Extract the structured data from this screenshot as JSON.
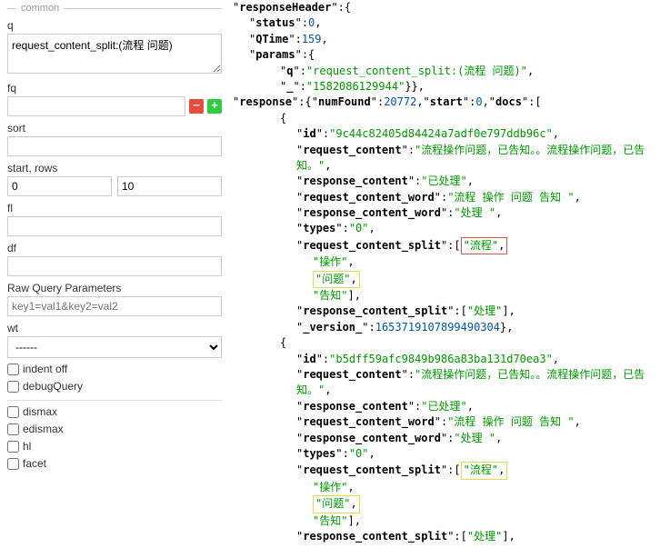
{
  "left": {
    "fieldset": "common",
    "q_label": "q",
    "q_value": "request_content_split:(流程 问题)",
    "fq_label": "fq",
    "fq_value": "",
    "sort_label": "sort",
    "sort_value": "",
    "startrows_label": "start, rows",
    "start_value": "0",
    "rows_value": "10",
    "fl_label": "fl",
    "fl_value": "",
    "df_label": "df",
    "df_value": "",
    "rawparams_label": "Raw Query Parameters",
    "rawparams_placeholder": "key1=val1&key2=val2",
    "rawparams_value": "",
    "wt_label": "wt",
    "wt_value": "------",
    "indent_label": "indent off",
    "debug_label": "debugQuery",
    "dismax_label": "dismax",
    "edismax_label": "edismax",
    "hl_label": "hl",
    "facet_label": "facet"
  },
  "json": {
    "responseHeader_key": "responseHeader",
    "status_key": "status",
    "status_val": "0",
    "qtime_key": "QTime",
    "qtime_val": "159",
    "params_key": "params",
    "q_key": "q",
    "q_val": "request_content_split:(流程 问题)",
    "underscore_key": "_",
    "underscore_val": "1582086129944",
    "response_key": "response",
    "numfound_key": "numFound",
    "numfound_val": "20772",
    "start_key": "start",
    "start_val": "0",
    "docs_key": "docs",
    "id_key": "id",
    "reqcontent_key": "request_content",
    "respcontent_key": "response_content",
    "reqword_key": "request_content_word",
    "respword_key": "response_content_word",
    "types_key": "types",
    "reqsplit_key": "request_content_split",
    "respsplit_key": "response_content_split",
    "version_key": "_version_",
    "doc1": {
      "id_val": "9c44c82405d84424a7adf0e797ddb96c",
      "reqcontent_val": "流程操作问题，已告知。。流程操作问题，已告知。",
      "respcontent_val": "已处理",
      "reqword_val": "流程 操作 问题 告知 ",
      "respword_val": "处理 ",
      "types_val": "0",
      "split1": "流程",
      "split2": "操作",
      "split3": "问题",
      "split4": "告知",
      "respsplit1": "处理",
      "version_val": "1653719107899490304"
    },
    "doc2": {
      "id_val": "b5dff59afc9849b986a83ba131d70ea3",
      "reqcontent_val": "流程操作问题，已告知。。流程操作问题，已告知。",
      "respcontent_val": "已处理",
      "reqword_val": "流程 操作 问题 告知 ",
      "respword_val": "处理 ",
      "types_val": "0",
      "split1": "流程",
      "split2": "操作",
      "split3": "问题",
      "split4": "告知",
      "respsplit1": "处理"
    }
  }
}
